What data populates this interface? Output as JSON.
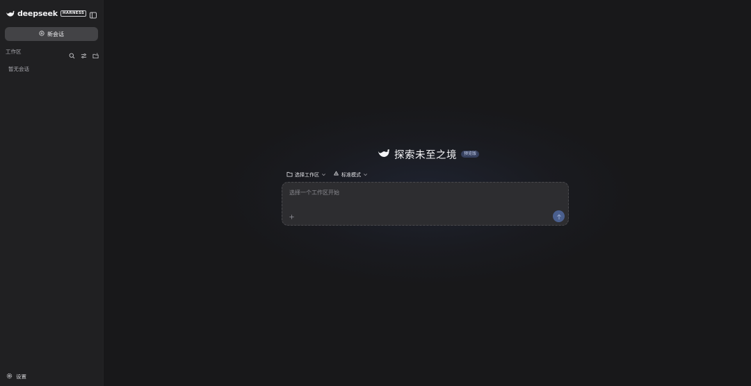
{
  "sidebar": {
    "brand_name": "deepseek",
    "brand_tag": "HARNESS",
    "new_chat_label": "新会话",
    "workspace_label": "工作区",
    "empty_text": "暂无会话",
    "settings_label": "设置"
  },
  "main": {
    "hero_title": "探索未至之境",
    "preview_badge": "预览版",
    "workspace_selector": "选择工作区",
    "mode_selector": "标准模式",
    "input_placeholder": "选择一个工作区开始"
  },
  "colors": {
    "background": "#18181a",
    "sidebar": "#202022",
    "accent": "#4a5f8e",
    "badge": "#36405e"
  },
  "icons": [
    "whale-logo-icon",
    "sidebar-toggle-icon",
    "plus-circle-icon",
    "search-icon",
    "sliders-icon",
    "new-folder-icon",
    "gear-icon",
    "folder-icon",
    "recycle-icon",
    "chevron-down-icon",
    "plus-icon",
    "arrow-up-icon"
  ]
}
